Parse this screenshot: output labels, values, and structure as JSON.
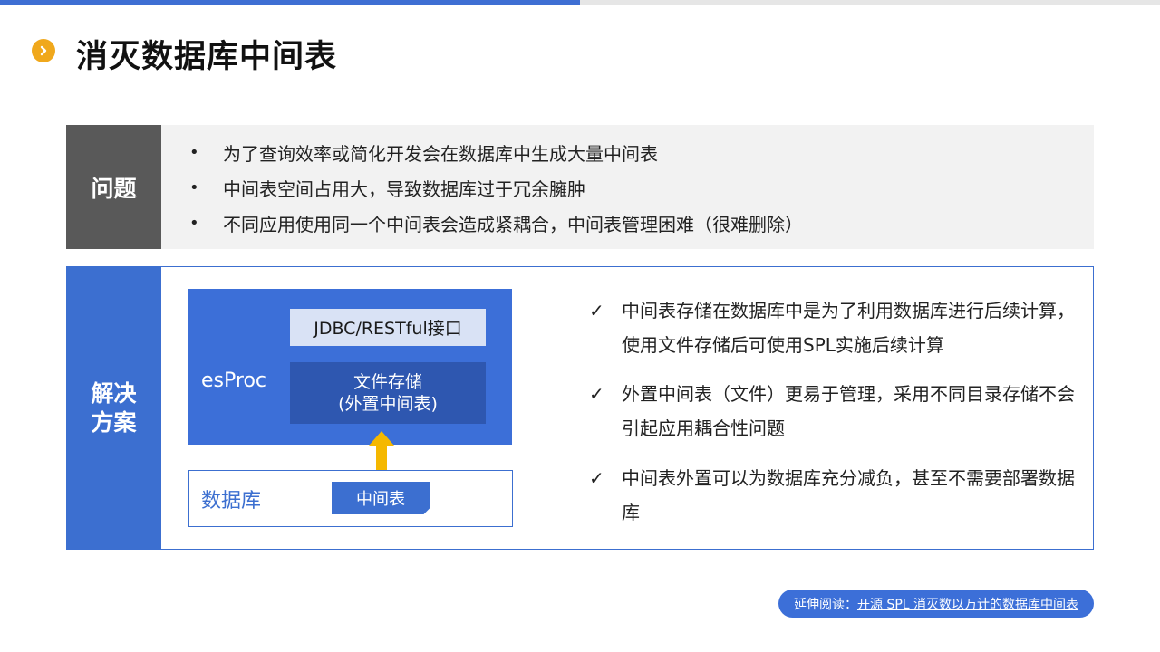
{
  "title": "消灭数据库中间表",
  "problem": {
    "label": "问题",
    "bullet": "•",
    "items": [
      "为了查询效率或简化开发会在数据库中生成大量中间表",
      "中间表空间占用大，导致数据库过于冗余臃肿",
      "不同应用使用同一个中间表会造成紧耦合，中间表管理困难（很难删除）"
    ]
  },
  "solution": {
    "label_line1": "解决",
    "label_line2": "方案",
    "diagram": {
      "esproc": "esProc",
      "interface": "JDBC/RESTful接口",
      "file_storage_line1": "文件存储",
      "file_storage_line2": "(外置中间表)",
      "database": "数据库",
      "intermediate_table": "中间表"
    },
    "check_mark": "✓",
    "points": [
      "中间表存储在数据库中是为了利用数据库进行后续计算，使用文件存储后可使用SPL实施后续计算",
      "外置中间表（文件）更易于管理，采用不同目录存储不会引起应用耦合性问题",
      "中间表外置可以为数据库充分减负，甚至不需要部署数据库"
    ]
  },
  "read_more": {
    "prefix": "延伸阅读：",
    "link": "开源 SPL 消灭数以万计的数据库中间表"
  },
  "colors": {
    "accent_blue": "#3c6fd0",
    "title_bullet": "#f0a81c",
    "arrow": "#f5b800",
    "problem_label": "#595959"
  }
}
